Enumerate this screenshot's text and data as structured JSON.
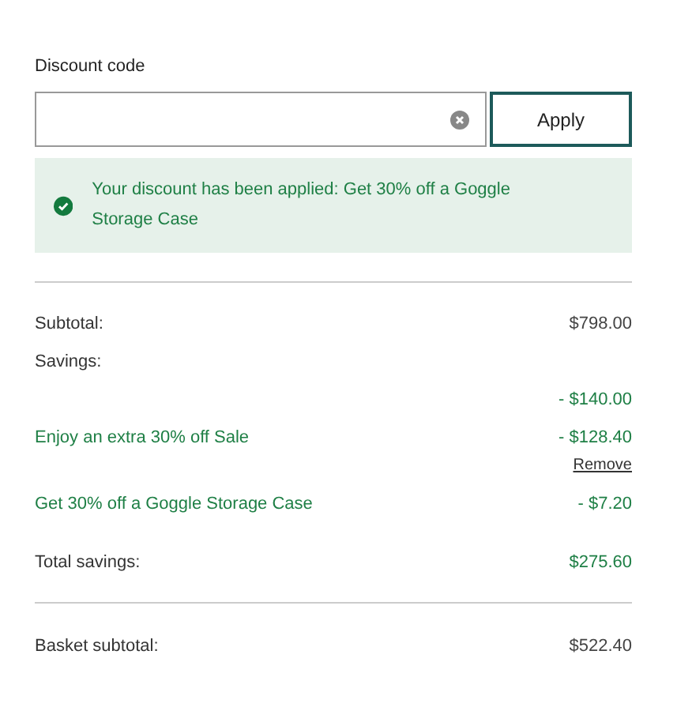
{
  "discount": {
    "label": "Discount code",
    "apply_button": "Apply",
    "message": "Your discount has been applied: Get 30% off a Goggle Storage Case"
  },
  "summary": [
    {
      "kind": "row",
      "label": "Subtotal:",
      "value": "$798.00",
      "highlighted": false
    },
    {
      "kind": "heading",
      "label": "Savings:"
    },
    {
      "kind": "row",
      "value": "- $140.00",
      "highlighted": true
    },
    {
      "kind": "row",
      "label": "Enjoy an extra 30% off Sale",
      "value": "- $128.40",
      "highlighted": true
    },
    {
      "kind": "link",
      "label": "Remove"
    },
    {
      "kind": "row",
      "label": "Get 30% off a Goggle Storage Case",
      "value": "- $7.20",
      "highlighted": true
    },
    {
      "kind": "total",
      "label": "Total savings:",
      "value": "$275.60",
      "highlighted": true
    },
    {
      "kind": "divider"
    },
    {
      "kind": "total",
      "label": "Basket subtotal:",
      "value": "$522.40",
      "highlighted": false
    }
  ]
}
